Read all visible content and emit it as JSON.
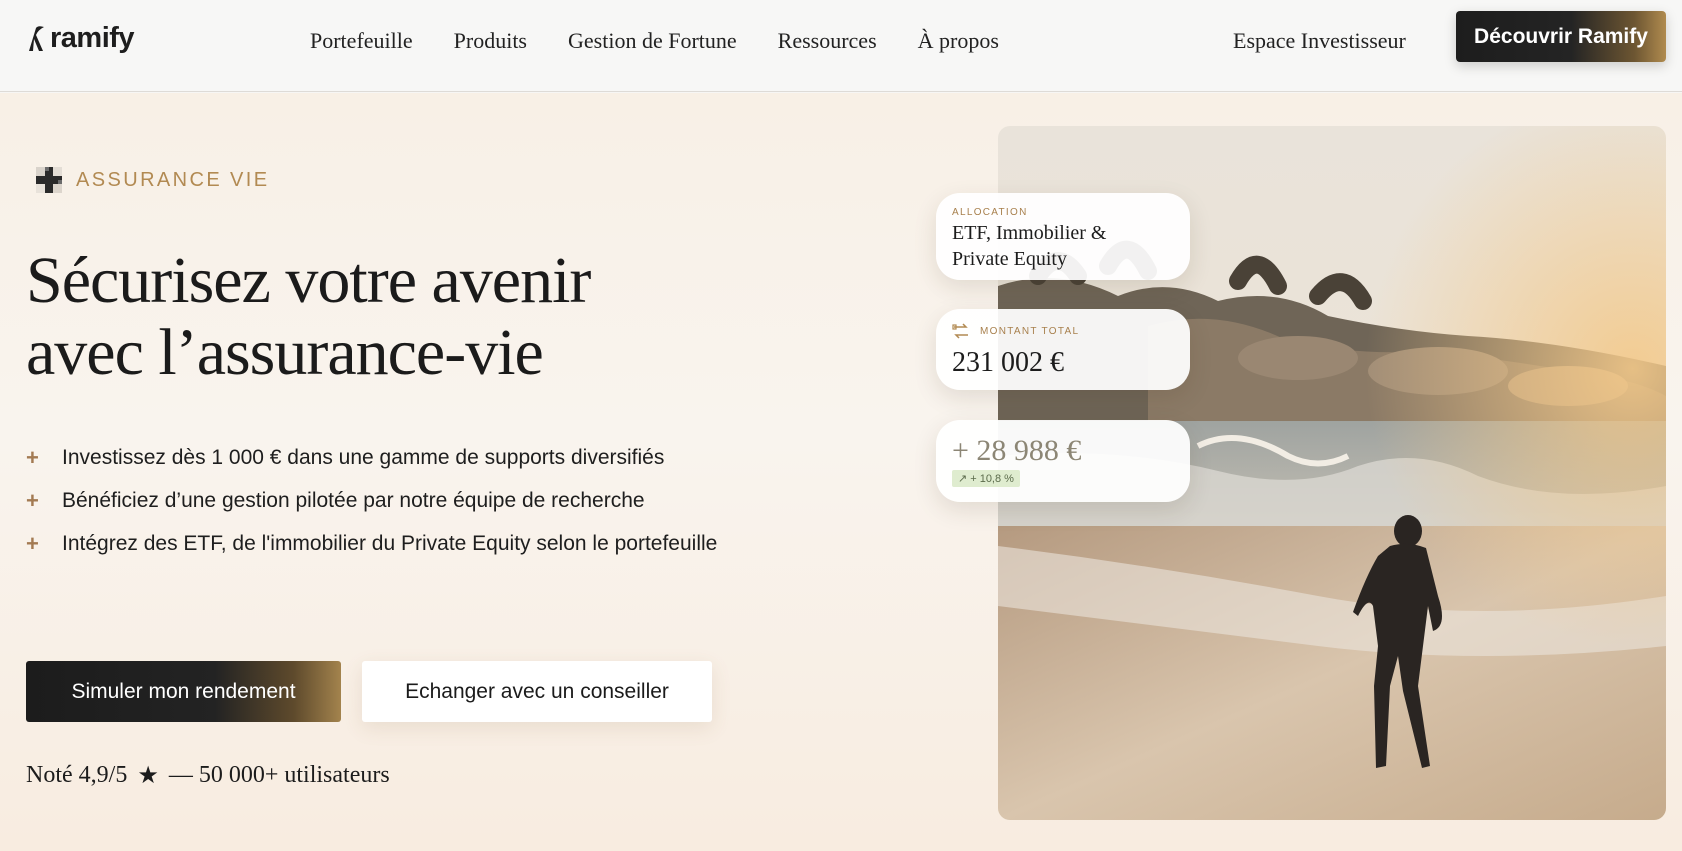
{
  "header": {
    "logo_text": "ramify",
    "nav": [
      "Portefeuille",
      "Produits",
      "Gestion de Fortune",
      "Ressources",
      "À propos"
    ],
    "espace_label": "Espace Investisseur",
    "cta_label": "Découvrir Ramify"
  },
  "hero": {
    "badge_label": "ASSURANCE VIE",
    "title_line1": "Sécurisez votre avenir",
    "title_line2": "avec l’assurance-vie",
    "bullets": [
      "Investissez dès 1 000 € dans une gamme de supports diversifiés",
      "Bénéficiez d’une gestion pilotée par notre équipe de recherche",
      "Intégrez des ETF, de l'immobilier du Private Equity selon le portefeuille"
    ],
    "primary_button": "Simuler mon rendement",
    "secondary_button": "Echanger avec un conseiller",
    "rating_prefix": "Noté 4,9/5",
    "rating_suffix": "— 50 000+ utilisateurs"
  },
  "cards": {
    "allocation_label": "ALLOCATION",
    "allocation_line1": "ETF, Immobilier &",
    "allocation_line2": "Private Equity",
    "total_label": "MONTANT TOTAL",
    "total_value": "231 002 €",
    "gain_value": "+ 28 988 €",
    "gain_pill": "+ 10,8 %"
  },
  "icons": {
    "logo": "ramify-logo-mark",
    "badge": "plus-pixel-icon",
    "bullet": "plus-icon",
    "rating": "star-icon",
    "total": "transfer-icon",
    "gain": "arrow-up-right-icon"
  },
  "colors": {
    "accent_gold": "#b28a52",
    "dark_button": "#1d1d1d",
    "gain_pill_bg": "#dfeccf"
  }
}
